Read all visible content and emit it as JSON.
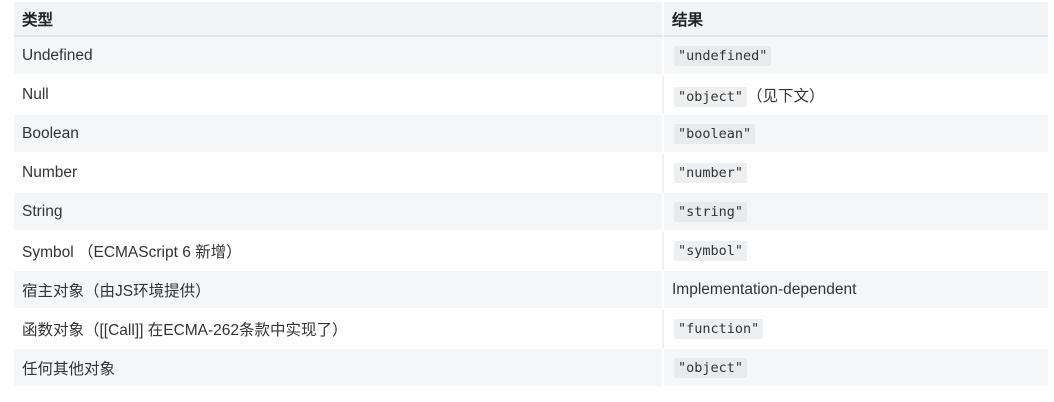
{
  "table": {
    "headers": {
      "type": "类型",
      "result": "结果"
    },
    "rows": [
      {
        "type": "Undefined",
        "result_code": "\"undefined\"",
        "result_text": ""
      },
      {
        "type": "Null",
        "result_code": "\"object\"",
        "result_text": "（见下文）"
      },
      {
        "type": "Boolean",
        "result_code": "\"boolean\"",
        "result_text": ""
      },
      {
        "type": "Number",
        "result_code": "\"number\"",
        "result_text": ""
      },
      {
        "type": "String",
        "result_code": "\"string\"",
        "result_text": ""
      },
      {
        "type": "Symbol （ECMAScript 6 新增）",
        "result_code": "\"symbol\"",
        "result_text": ""
      },
      {
        "type": "宿主对象（由JS环境提供）",
        "result_code": "",
        "result_text": "Implementation-dependent"
      },
      {
        "type": "函数对象（[[Call]] 在ECMA-262条款中实现了）",
        "result_code": "\"function\"",
        "result_text": ""
      },
      {
        "type": "任何其他对象",
        "result_code": "\"object\"",
        "result_text": ""
      }
    ]
  }
}
